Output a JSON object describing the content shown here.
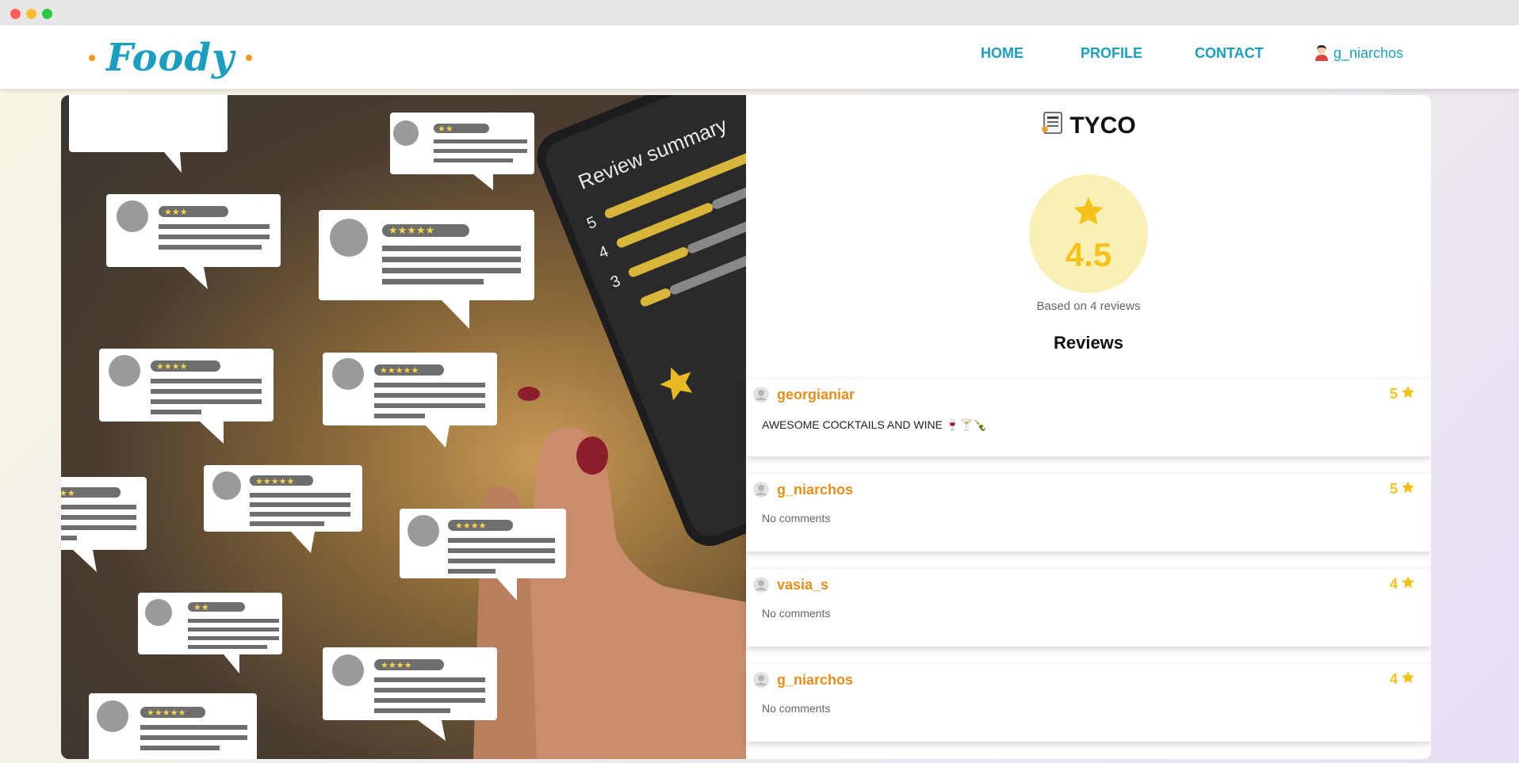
{
  "window": {
    "traffic_lights": [
      "close",
      "minimize",
      "maximize"
    ]
  },
  "navbar": {
    "logo_text": "Foody",
    "links": [
      {
        "label": "HOME"
      },
      {
        "label": "PROFILE"
      },
      {
        "label": "CONTACT"
      }
    ],
    "user": {
      "icon": "user-avatar-icon",
      "name": "g_niarchos"
    }
  },
  "restaurant": {
    "icon": "menu-card-icon",
    "name": "TYCO",
    "rating": "4.5",
    "based_on": "Based on 4 reviews",
    "reviews_heading": "Reviews"
  },
  "reviews": [
    {
      "user": "georgianiar",
      "score": "5",
      "comment": "AWESOME COCKTAILS AND WINE 🍷🍸🍾",
      "has_comment": true
    },
    {
      "user": "g_niarchos",
      "score": "5",
      "comment": "No comments",
      "has_comment": false
    },
    {
      "user": "vasia_s",
      "score": "4",
      "comment": "No comments",
      "has_comment": false
    },
    {
      "user": "g_niarchos",
      "score": "4",
      "comment": "No comments",
      "has_comment": false
    }
  ],
  "hero_image": {
    "phone_text": "Review summary",
    "summary_levels": [
      "5",
      "4",
      "3"
    ]
  },
  "colors": {
    "brand": "#1a9fc0",
    "accent_orange": "#e88e1a",
    "star_yellow": "#f5c21b",
    "rating_bg": "#faf0b6"
  }
}
